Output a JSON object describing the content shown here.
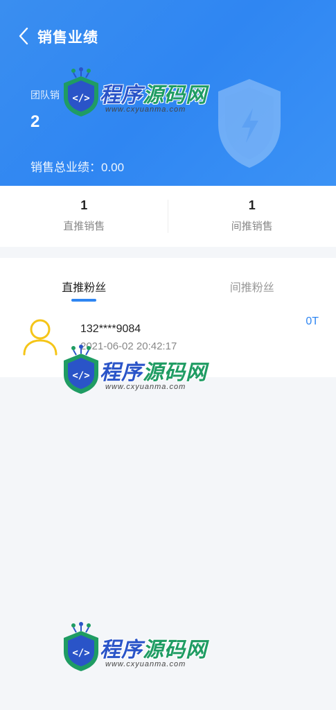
{
  "header": {
    "title": "销售业绩",
    "team_label": "团队销",
    "team_value": "2",
    "total_label": "销售总业绩：0.00"
  },
  "stats": [
    {
      "value": "1",
      "label": "直推销售"
    },
    {
      "value": "1",
      "label": "间推销售"
    }
  ],
  "tabs": [
    {
      "label": "直推粉丝",
      "active": true
    },
    {
      "label": "间推粉丝",
      "active": false
    }
  ],
  "list": [
    {
      "phone": "132****9084",
      "date": "2021-06-02 20:42:17",
      "amount": "0T"
    }
  ],
  "watermark": {
    "text_a": "程序",
    "text_b": "源码网",
    "url": "www.cxyuanma.com"
  },
  "colors": {
    "accent": "#2f86f2",
    "avatar": "#f5c518"
  }
}
